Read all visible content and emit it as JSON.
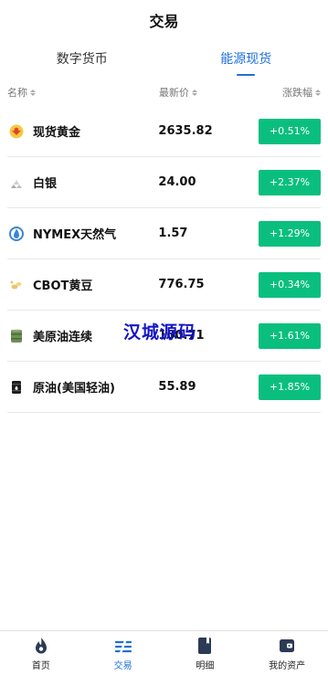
{
  "header": {
    "title": "交易"
  },
  "tabs": [
    {
      "label": "数字货币",
      "active": false
    },
    {
      "label": "能源现货",
      "active": true
    }
  ],
  "columns": {
    "name": "名称",
    "price": "最新价",
    "change": "涨跌幅"
  },
  "rows": [
    {
      "name": "现货黄金",
      "price": "2635.82",
      "change": "+0.51%",
      "icon": "gold-icon"
    },
    {
      "name": "白银",
      "price": "24.00",
      "change": "+2.37%",
      "icon": "silver-icon"
    },
    {
      "name": "NYMEX天然气",
      "price": "1.57",
      "change": "+1.29%",
      "icon": "gas-flame-icon"
    },
    {
      "name": "CBOT黄豆",
      "price": "776.75",
      "change": "+0.34%",
      "icon": "soybean-icon"
    },
    {
      "name": "美原油连续",
      "price": "100.71",
      "change": "+1.61%",
      "icon": "oil-barrel-icon"
    },
    {
      "name": "原油(美国轻油)",
      "price": "55.89",
      "change": "+1.85%",
      "icon": "oil-drum-icon"
    }
  ],
  "watermark": "汉城源码",
  "colors": {
    "accent": "#1e6fd9",
    "rise": "#0abf7e"
  },
  "tabbar": [
    {
      "label": "首页",
      "icon": "flame-home-icon"
    },
    {
      "label": "交易",
      "icon": "trade-icon",
      "active": true
    },
    {
      "label": "明细",
      "icon": "detail-book-icon"
    },
    {
      "label": "我的资产",
      "icon": "wallet-icon"
    }
  ]
}
